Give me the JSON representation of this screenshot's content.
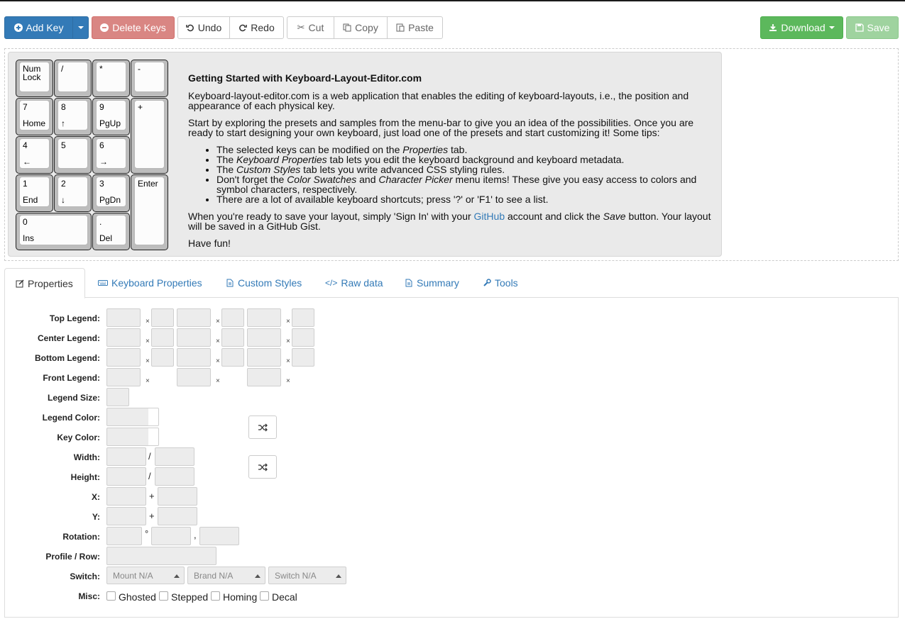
{
  "toolbar": {
    "add_key": "Add Key",
    "delete_keys": "Delete Keys",
    "undo": "Undo",
    "redo": "Redo",
    "cut": "Cut",
    "copy": "Copy",
    "paste": "Paste",
    "download": "Download",
    "save": "Save"
  },
  "keys": [
    {
      "top": "Num\nLock",
      "bottom": ""
    },
    {
      "top": "/",
      "bottom": ""
    },
    {
      "top": "*",
      "bottom": ""
    },
    {
      "top": "-",
      "bottom": ""
    },
    {
      "top": "7",
      "bottom": "Home"
    },
    {
      "top": "8",
      "bottom": "↑"
    },
    {
      "top": "9",
      "bottom": "PgUp"
    },
    {
      "top": "+",
      "bottom": ""
    },
    {
      "top": "4",
      "bottom": "←"
    },
    {
      "top": "5",
      "bottom": ""
    },
    {
      "top": "6",
      "bottom": "→"
    },
    {
      "top": "1",
      "bottom": "End"
    },
    {
      "top": "2",
      "bottom": "↓"
    },
    {
      "top": "3",
      "bottom": "PgDn"
    },
    {
      "top": "Enter",
      "bottom": ""
    },
    {
      "top": "0",
      "bottom": "Ins"
    },
    {
      "top": ".",
      "bottom": "Del"
    }
  ],
  "info": {
    "title": "Getting Started with Keyboard-Layout-Editor.com",
    "p1": "Keyboard-layout-editor.com is a web application that enables the editing of keyboard-layouts, i.e., the position and appearance of each physical key.",
    "p2": "Start by exploring the presets and samples from the menu-bar to give you an idea of the possibilities. Once you are ready to start designing your own keyboard, just load one of the presets and start customizing it! Some tips:",
    "tip1_a": "The selected keys can be modified on the ",
    "tip1_em": "Properties",
    "tip1_b": " tab.",
    "tip2_a": "The ",
    "tip2_em": "Keyboard Properties",
    "tip2_b": " tab lets you edit the keyboard background and keyboard metadata.",
    "tip3_a": "The ",
    "tip3_em": "Custom Styles",
    "tip3_b": " tab lets you write advanced CSS styling rules.",
    "tip4_a": "Don't forget the ",
    "tip4_em1": "Color Swatches",
    "tip4_and": " and ",
    "tip4_em2": "Character Picker",
    "tip4_b": " menu items! These give you easy access to colors and symbol characters, respectively.",
    "tip5": "There are a lot of available keyboard shortcuts; press '?' or 'F1' to see a list.",
    "p3_a": "When you're ready to save your layout, simply 'Sign In' with your ",
    "p3_link": "GitHub",
    "p3_b": " account and click the ",
    "p3_em": "Save",
    "p3_c": " button. Your layout will be saved in a GitHub Gist.",
    "p4": "Have fun!"
  },
  "tabs": [
    "Properties",
    "Keyboard Properties",
    "Custom Styles",
    "Raw data",
    "Summary",
    "Tools"
  ],
  "form": {
    "top_legend": "Top Legend:",
    "center_legend": "Center Legend:",
    "bottom_legend": "Bottom Legend:",
    "front_legend": "Front Legend:",
    "legend_size": "Legend Size:",
    "legend_color": "Legend Color:",
    "key_color": "Key Color:",
    "width": "Width:",
    "height": "Height:",
    "x": "X:",
    "y": "Y:",
    "rotation": "Rotation:",
    "profile_row": "Profile / Row:",
    "switch": "Switch:",
    "misc": "Misc:",
    "x_mark": "×",
    "slash": "/",
    "plus": "+",
    "degree": "°",
    "comma": ",",
    "mount": "Mount N/A",
    "brand": "Brand N/A",
    "switch_sel": "Switch N/A",
    "ghosted": "Ghosted",
    "stepped": "Stepped",
    "homing": "Homing",
    "decal": "Decal"
  },
  "colors": {
    "primary": "#337ab7",
    "danger": "#d98683",
    "success": "#5cb85c",
    "success_disabled": "#9fd39f"
  }
}
